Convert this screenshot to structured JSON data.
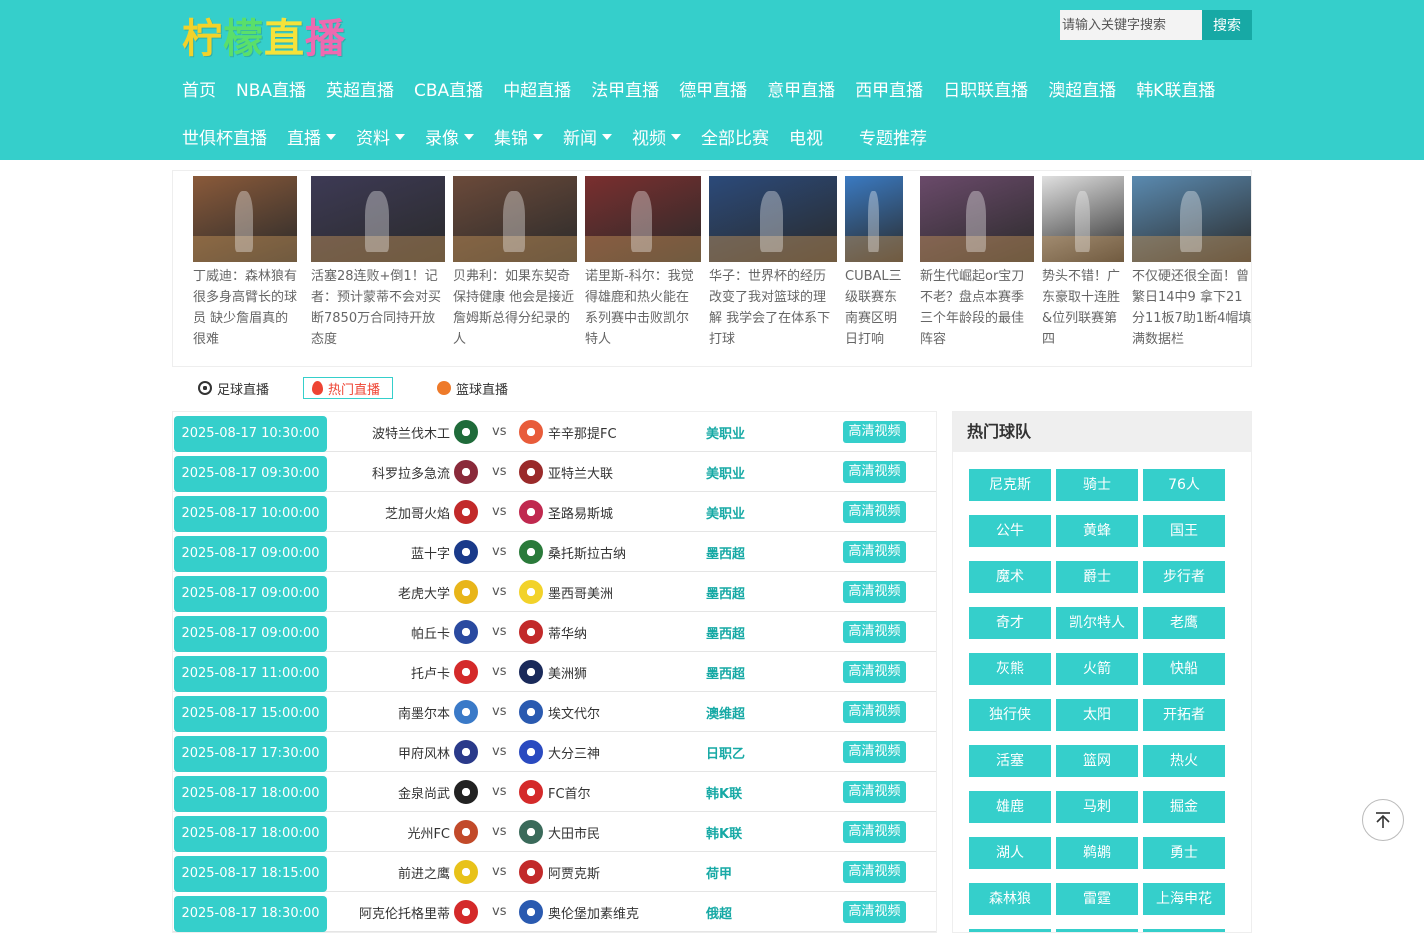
{
  "site": {
    "logo_text": "柠檬直播",
    "colors": {
      "primary": "#35cfcb",
      "primary_dark": "#17a9a5",
      "accent_red": "#ee4433"
    }
  },
  "search": {
    "placeholder": "请输入关键字搜索",
    "button_label": "搜索"
  },
  "nav": {
    "row1": [
      "首页",
      "NBA直播",
      "英超直播",
      "CBA直播",
      "中超直播",
      "法甲直播",
      "德甲直播",
      "意甲直播",
      "西甲直播",
      "日职联直播",
      "澳超直播",
      "韩K联直播"
    ],
    "row2": [
      {
        "label": "世俱杯直播",
        "dropdown": false
      },
      {
        "label": "直播",
        "dropdown": true
      },
      {
        "label": "资料",
        "dropdown": true
      },
      {
        "label": "录像",
        "dropdown": true
      },
      {
        "label": "集锦",
        "dropdown": true
      },
      {
        "label": "新闻",
        "dropdown": true
      },
      {
        "label": "视频",
        "dropdown": true
      },
      {
        "label": "全部比赛",
        "dropdown": false
      },
      {
        "label": "电视",
        "dropdown": false
      },
      {
        "label": "专题推荐",
        "dropdown": false
      }
    ]
  },
  "news": [
    {
      "title": "丁威迪：森林狼有很多身高臂长的球员 缺少詹眉真的很难",
      "thumb_color": "#8a5a3a"
    },
    {
      "title": "活塞28连败+倒1！记者：预计蒙蒂不会对买断7850万合同持开放态度",
      "thumb_color": "#3d3a55"
    },
    {
      "title": "贝弗利：如果东契奇保持健康 他会是接近詹姆斯总得分纪录的人",
      "thumb_color": "#6b4a3a"
    },
    {
      "title": "诺里斯-科尔：我觉得雄鹿和热火能在系列赛中击败凯尔特人",
      "thumb_color": "#7a2f2f"
    },
    {
      "title": "华子：世界杯的经历改变了我对篮球的理解 我学会了在体系下打球",
      "thumb_color": "#2b4a7a"
    },
    {
      "title": "CUBAL三级联赛东南赛区明日打响",
      "thumb_color": "#3a7ac2"
    },
    {
      "title": "新生代崛起or宝刀不老？盘点本赛季三个年龄段的最佳阵容",
      "thumb_color": "#6a4a6a"
    },
    {
      "title": "势头不错！广东豪取十连胜&位列联赛第四",
      "thumb_color": "#e0e0e0"
    },
    {
      "title": "不仅硬还很全面！曾繁日14中9 拿下21分11板7助1断4帽填满数据栏",
      "thumb_color": "#5a8ab0"
    }
  ],
  "tabs": [
    {
      "label": "足球直播",
      "icon": "soccer-ball-icon",
      "active": false
    },
    {
      "label": "热门直播",
      "icon": "fire-icon",
      "active": true
    },
    {
      "label": "篮球直播",
      "icon": "basketball-icon",
      "active": false
    }
  ],
  "matches_meta": {
    "vs_label": "vs",
    "button_label": "高清视频"
  },
  "matches": [
    {
      "time": "2025-08-17 10:30:00",
      "home": "波特兰伐木工",
      "away": "辛辛那提FC",
      "league": "美职业",
      "home_color": "#1f6b3a",
      "away_color": "#e85c3a"
    },
    {
      "time": "2025-08-17 09:30:00",
      "home": "科罗拉多急流",
      "away": "亚特兰大联",
      "league": "美职业",
      "home_color": "#8a2a3a",
      "away_color": "#9a2a2a"
    },
    {
      "time": "2025-08-17 10:00:00",
      "home": "芝加哥火焰",
      "away": "圣路易斯城",
      "league": "美职业",
      "home_color": "#c22a2a",
      "away_color": "#c0294f"
    },
    {
      "time": "2025-08-17 09:00:00",
      "home": "蓝十字",
      "away": "桑托斯拉古纳",
      "league": "墨西超",
      "home_color": "#1a3a8a",
      "away_color": "#2a7a3a"
    },
    {
      "time": "2025-08-17 09:00:00",
      "home": "老虎大学",
      "away": "墨西哥美洲",
      "league": "墨西超",
      "home_color": "#e8b51a",
      "away_color": "#f2d22a"
    },
    {
      "time": "2025-08-17 09:00:00",
      "home": "帕丘卡",
      "away": "蒂华纳",
      "league": "墨西超",
      "home_color": "#2a4aa0",
      "away_color": "#c22a2a"
    },
    {
      "time": "2025-08-17 11:00:00",
      "home": "托卢卡",
      "away": "美洲狮",
      "league": "墨西超",
      "home_color": "#d42a2a",
      "away_color": "#1a2a5a"
    },
    {
      "time": "2025-08-17 15:00:00",
      "home": "南墨尔本",
      "away": "埃文代尔",
      "league": "澳维超",
      "home_color": "#3a7ac8",
      "away_color": "#2a5ab0"
    },
    {
      "time": "2025-08-17 17:30:00",
      "home": "甲府风林",
      "away": "大分三神",
      "league": "日职乙",
      "home_color": "#2a3a8a",
      "away_color": "#2a4ac0"
    },
    {
      "time": "2025-08-17 18:00:00",
      "home": "金泉尚武",
      "away": "FC首尔",
      "league": "韩K联",
      "home_color": "#222222",
      "away_color": "#d42a2a"
    },
    {
      "time": "2025-08-17 18:00:00",
      "home": "光州FC",
      "away": "大田市民",
      "league": "韩K联",
      "home_color": "#c24a2a",
      "away_color": "#3a6a5a"
    },
    {
      "time": "2025-08-17 18:15:00",
      "home": "前进之鹰",
      "away": "阿贾克斯",
      "league": "荷甲",
      "home_color": "#e8c21a",
      "away_color": "#c22a2a"
    },
    {
      "time": "2025-08-17 18:30:00",
      "home": "阿克伦托格里蒂",
      "away": "奥伦堡加素维克",
      "league": "俄超",
      "home_color": "#d42a2a",
      "away_color": "#2a5ab0"
    }
  ],
  "sidebar": {
    "title": "热门球队",
    "teams": [
      "尼克斯",
      "骑士",
      "76人",
      "公牛",
      "黄蜂",
      "国王",
      "魔术",
      "爵士",
      "步行者",
      "奇才",
      "凯尔特人",
      "老鹰",
      "灰熊",
      "火箭",
      "快船",
      "独行侠",
      "太阳",
      "开拓者",
      "活塞",
      "篮网",
      "热火",
      "雄鹿",
      "马刺",
      "掘金",
      "湖人",
      "鹈鹕",
      "勇士",
      "森林狼",
      "雷霆",
      "上海申花",
      "",
      "",
      ""
    ]
  }
}
